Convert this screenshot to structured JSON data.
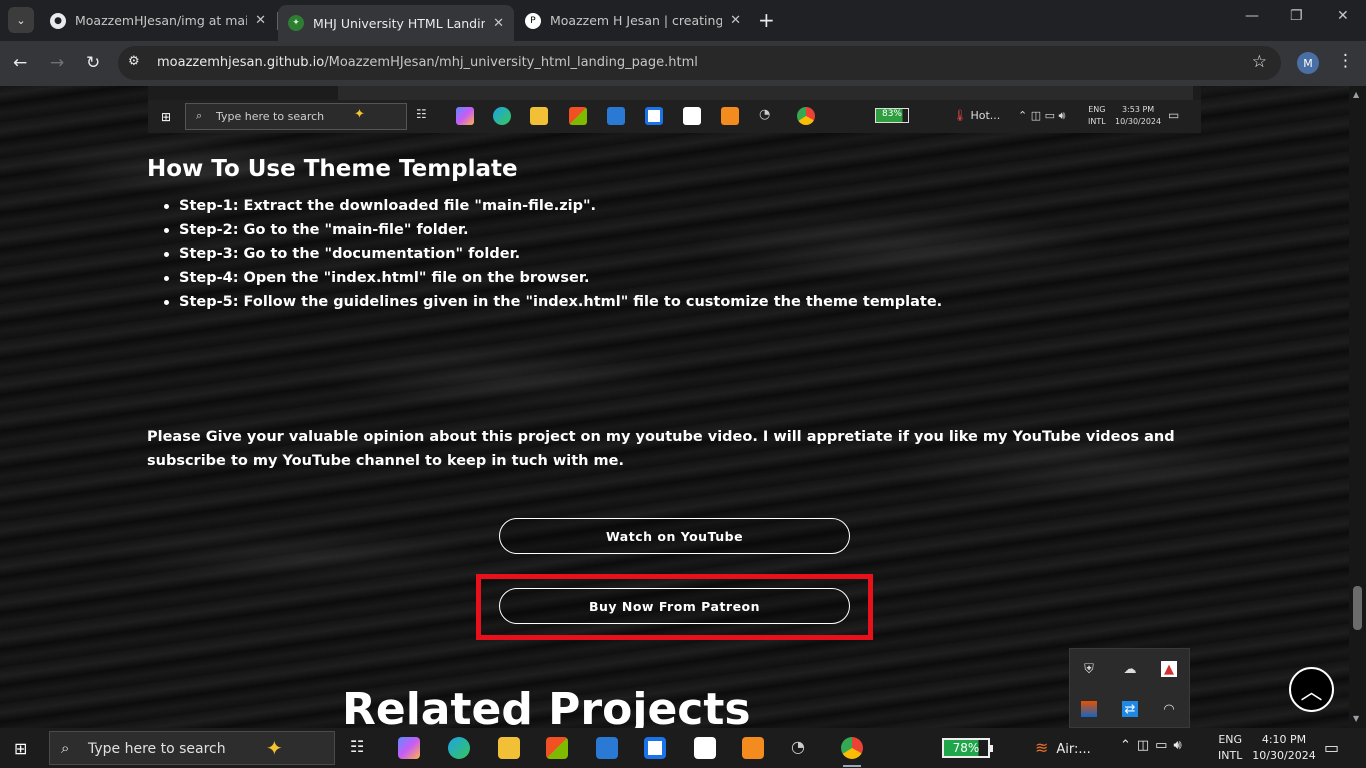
{
  "browser": {
    "tabs": [
      {
        "title": "MoazzemHJesan/img at main · ",
        "favicon": "github-icon",
        "active": false
      },
      {
        "title": "MHJ University HTML Landing P",
        "favicon": "site-icon",
        "active": true
      },
      {
        "title": "Moazzem H Jesan | creating we",
        "favicon": "patreon-icon",
        "active": false
      }
    ],
    "tab_close_glyph": "✕",
    "new_tab_glyph": "+",
    "url_host": "moazzemhjesan.github.io",
    "url_path": "/MoazzemHJesan/mhj_university_html_landing_page.html",
    "profile_initial": "M",
    "window_controls": [
      "—",
      "❐",
      "✕"
    ]
  },
  "embedded_taskbar": {
    "search_placeholder": "Type here to search",
    "battery": "83%",
    "battery_level": 0.83,
    "weather": "Hot...",
    "lang": [
      "ENG",
      "INTL"
    ],
    "time": "3:53 PM",
    "date": "10/30/2024"
  },
  "page": {
    "heading": "How To Use Theme Template",
    "steps": [
      "Step-1: Extract the downloaded file \"main-file.zip\".",
      "Step-2: Go to the \"main-file\" folder.",
      "Step-3: Go to the \"documentation\" folder.",
      "Step-4: Open the \"index.html\" file on the browser.",
      "Step-5: Follow the guidelines given in the \"index.html\" file to customize the theme template."
    ],
    "opinion": "Please Give your valuable opinion about this project on my youtube video. I will appretiate if you like my YouTube videos and subscribe to my YouTube channel to keep in tuch with me.",
    "youtube_button": "Watch on YouTube",
    "patreon_button": "Buy Now From Patreon",
    "related_heading": "Related Projects",
    "highlight_color": "#e8101a"
  },
  "taskbar": {
    "search_placeholder": "Type here to search",
    "battery": "78%",
    "battery_level": 0.78,
    "weather": "Air:...",
    "lang": [
      "ENG",
      "INTL"
    ],
    "time": "4:10 PM",
    "date": "10/30/2024"
  }
}
